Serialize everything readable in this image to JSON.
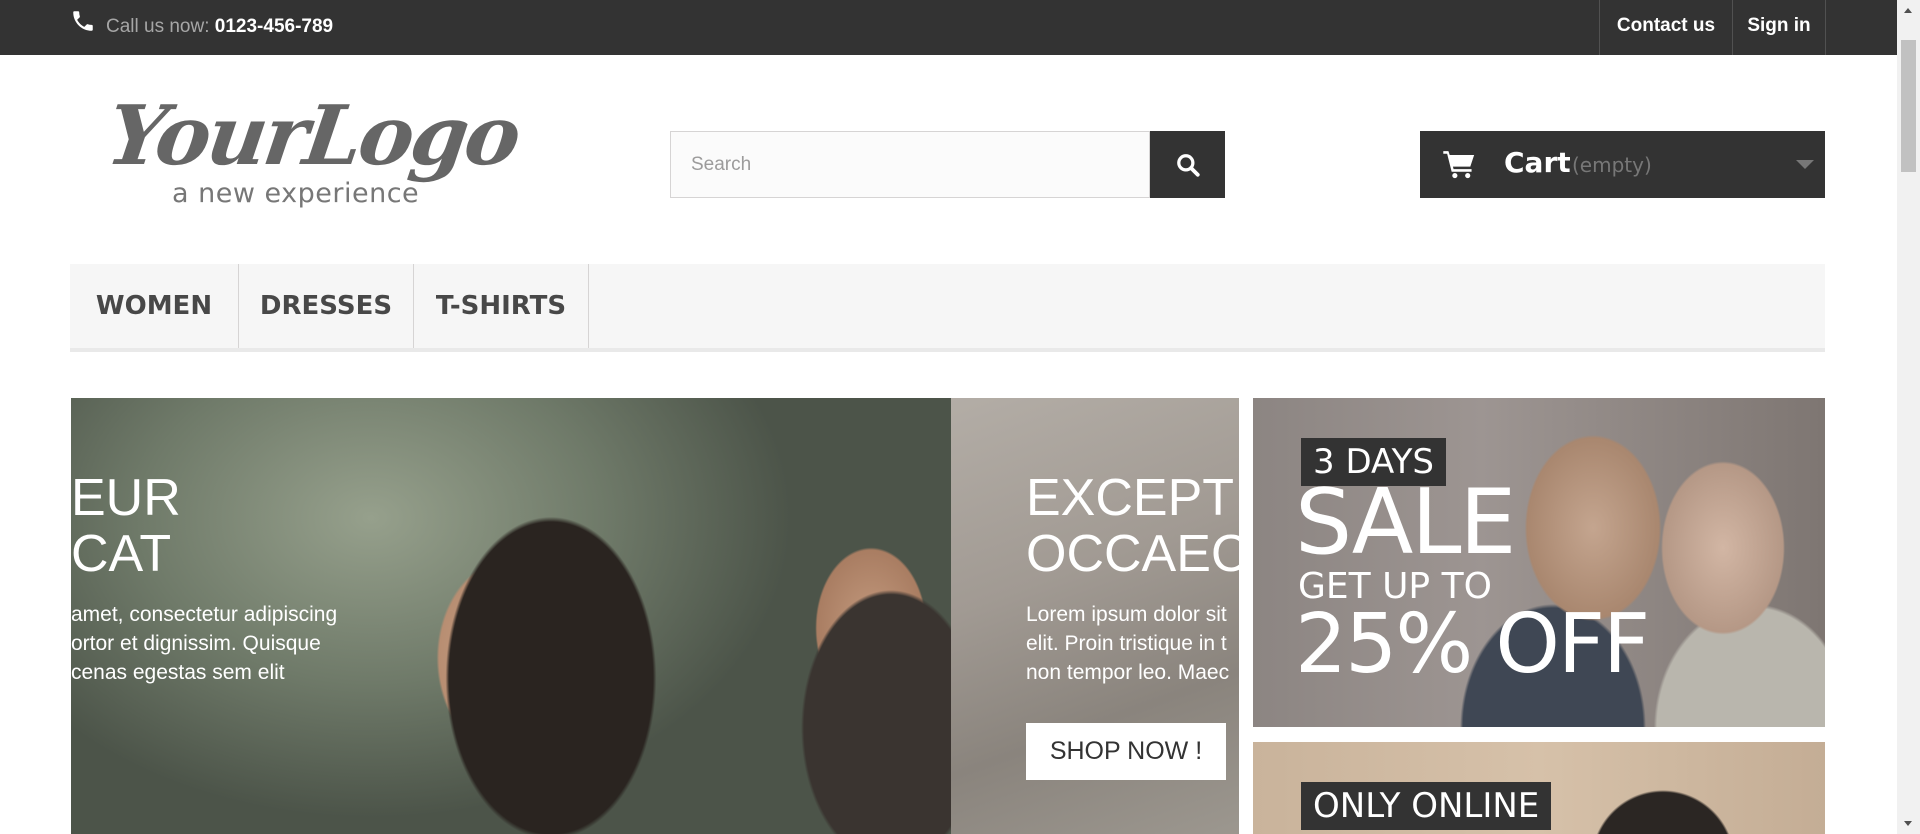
{
  "topbar": {
    "call_prefix": "Call us now:",
    "phone": "0123-456-789",
    "contact_label": "Contact us",
    "signin_label": "Sign in"
  },
  "logo": {
    "script": "YourLogo",
    "tagline": "a new experience"
  },
  "search": {
    "placeholder": "Search"
  },
  "cart": {
    "label": "Cart",
    "status": "(empty)"
  },
  "nav": {
    "items": [
      {
        "label": "WOMEN"
      },
      {
        "label": "DRESSES"
      },
      {
        "label": "T-SHIRTS"
      }
    ]
  },
  "hero": {
    "slide1": {
      "heading_line1": "EUR",
      "heading_line2": "CAT",
      "text_line1": "amet, consectetur adipiscing",
      "text_line2": "ortor et dignissim. Quisque",
      "text_line3": "cenas egestas sem elit"
    },
    "slide2": {
      "heading_line1": "EXCEPT",
      "heading_line2": "OCCAEC",
      "text_line1": "Lorem ipsum dolor sit",
      "text_line2": "elit. Proin tristique in t",
      "text_line3": "non tempor leo. Maec",
      "button_label": "SHOP NOW !"
    }
  },
  "banners": {
    "sale": {
      "tag": "3 DAYS",
      "title": "SALE",
      "subtitle": "GET UP TO",
      "discount": "25% OFF"
    },
    "online": {
      "tag": "ONLY ONLINE"
    }
  }
}
